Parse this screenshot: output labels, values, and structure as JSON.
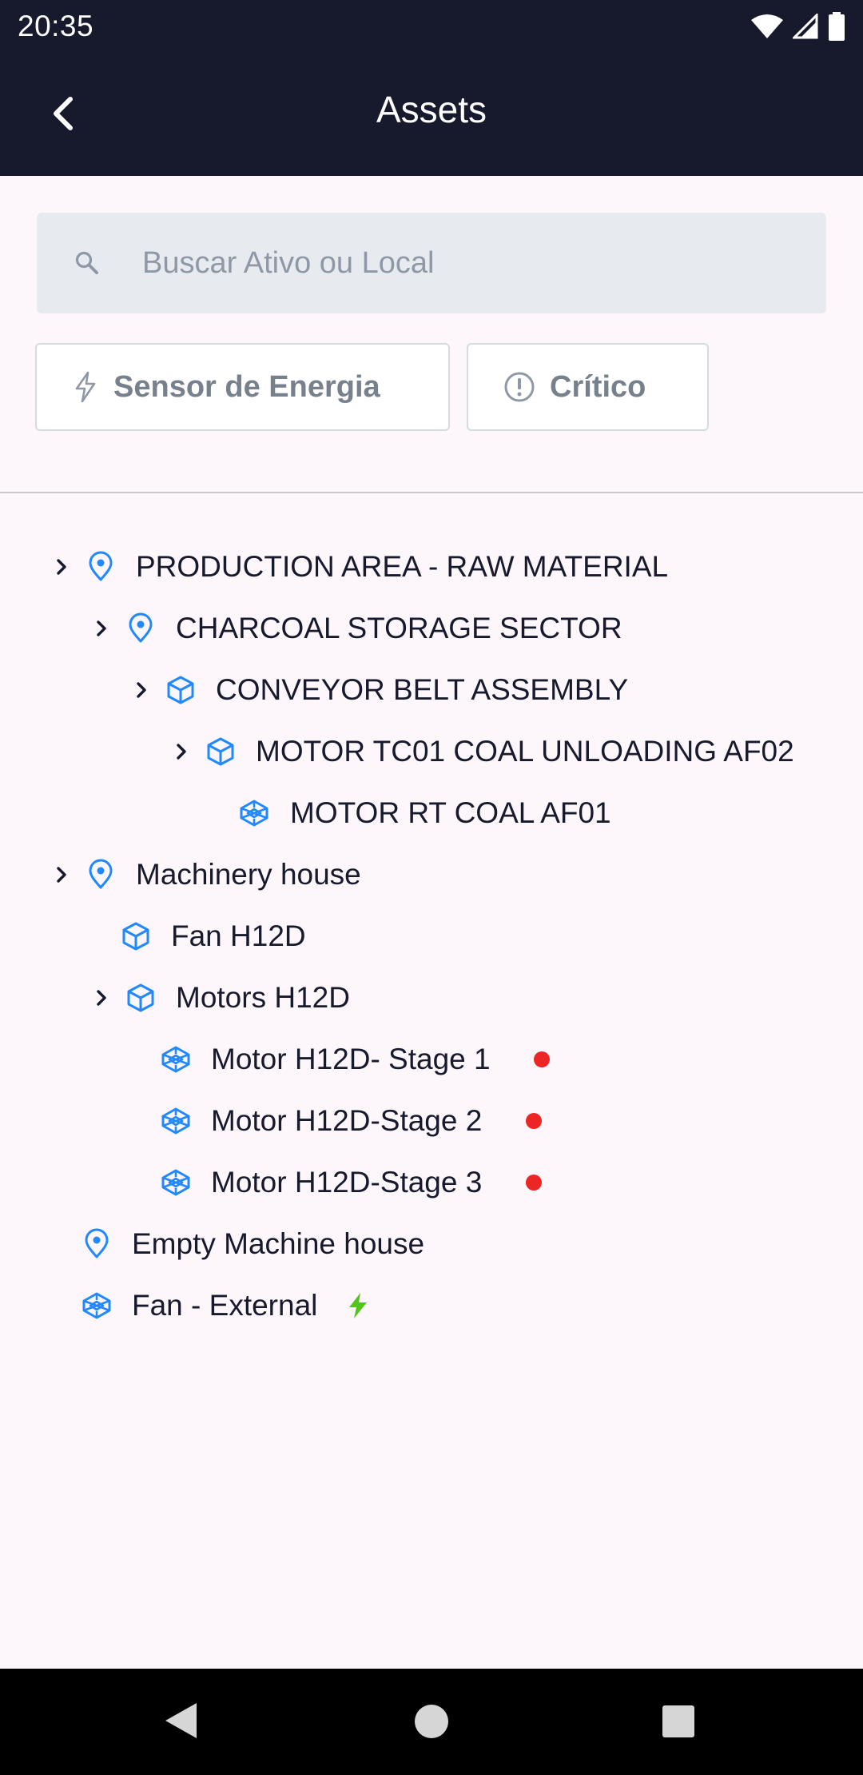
{
  "status_bar": {
    "time": "20:35"
  },
  "app_bar": {
    "title": "Assets"
  },
  "search": {
    "placeholder": "Buscar Ativo ou Local"
  },
  "filters": {
    "energy_label": "Sensor de Energia",
    "critical_label": "Crítico"
  },
  "tree": [
    {
      "label": "PRODUCTION AREA - RAW MATERIAL",
      "type": "location",
      "expandable": true,
      "status": "none"
    },
    {
      "label": "CHARCOAL STORAGE SECTOR",
      "type": "location",
      "expandable": true,
      "status": "none"
    },
    {
      "label": "CONVEYOR BELT ASSEMBLY",
      "type": "asset",
      "expandable": true,
      "status": "none"
    },
    {
      "label": "MOTOR TC01 COAL UNLOADING AF02",
      "type": "asset",
      "expandable": true,
      "status": "none"
    },
    {
      "label": "MOTOR RT COAL AF01",
      "type": "component",
      "expandable": false,
      "status": "none"
    },
    {
      "label": "Machinery house",
      "type": "location",
      "expandable": true,
      "status": "none"
    },
    {
      "label": "Fan H12D",
      "type": "asset",
      "expandable": false,
      "status": "none"
    },
    {
      "label": "Motors H12D",
      "type": "asset",
      "expandable": true,
      "status": "none"
    },
    {
      "label": "Motor H12D- Stage 1",
      "type": "component",
      "expandable": false,
      "status": "critical"
    },
    {
      "label": "Motor H12D-Stage 2",
      "type": "component",
      "expandable": false,
      "status": "critical"
    },
    {
      "label": "Motor H12D-Stage 3",
      "type": "component",
      "expandable": false,
      "status": "critical"
    },
    {
      "label": "Empty Machine house",
      "type": "location",
      "expandable": false,
      "status": "none"
    },
    {
      "label": "Fan - External",
      "type": "component",
      "expandable": false,
      "status": "energy"
    }
  ],
  "colors": {
    "header_bg": "#17192d",
    "icon_blue": "#2188ff",
    "critical_red": "#ec2525",
    "energy_green": "#52c41a"
  }
}
